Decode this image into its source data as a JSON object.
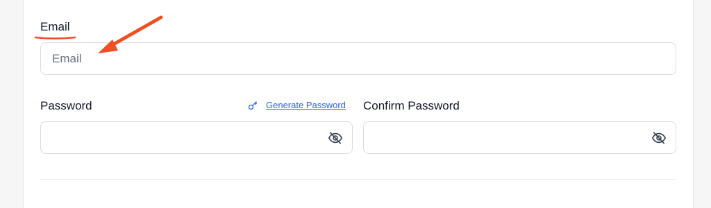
{
  "form": {
    "email": {
      "label": "Email",
      "placeholder": "Email",
      "value": ""
    },
    "password": {
      "label": "Password",
      "value": "",
      "generate_label": "Generate Password"
    },
    "confirm_password": {
      "label": "Confirm Password",
      "value": ""
    }
  },
  "annotation": {
    "color": "#f04e23",
    "icon": "arrow-pointing-to-email-field"
  }
}
